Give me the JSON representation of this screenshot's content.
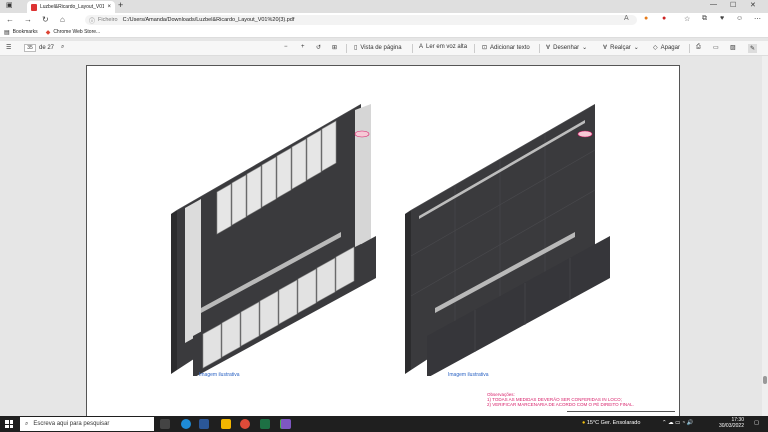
{
  "tab": {
    "title": "Luzbel&Ricardo_Layout_V01 (3)...",
    "close": "×"
  },
  "address": {
    "label": "Ficheiro",
    "url": "C:/Users/Amanda/Downloads/Luzbel&Ricardo_Layout_V01%20(3).pdf"
  },
  "bookmarks": [
    {
      "label": "Bookmarks"
    },
    {
      "label": "Chrome Web Store..."
    }
  ],
  "pdf_toolbar": {
    "page_current": "35",
    "page_total": "de 27",
    "page_view": "Vista de página",
    "read_aloud": "Ler em voz alta",
    "add_text": "Adicionar texto",
    "draw": "Desenhar",
    "highlight": "Realçar",
    "erase": "Apagar"
  },
  "document": {
    "captions": [
      "Imagem ilustrativa",
      "Imagem ilustrativa"
    ],
    "notes_title": "Observações:",
    "notes": [
      "1) TODAS AS MEDIDAS DEVERÃO SER CONFERIDAS IN LOCO;",
      "2) VERIFICAR MARCENARIA DE ACORDO COM O PÉ DIREITO FINAL."
    ],
    "tag_label": "A1"
  },
  "taskbar": {
    "search_placeholder": "Escreva aqui para pesquisar",
    "weather": "15°C  Ger. Ensolarado",
    "time": "17:30",
    "date": "30/03/2022"
  },
  "colors": {
    "panel_dark": "#3a3a3d",
    "panel_light": "#e4e4e4",
    "caption": "#2b63c4",
    "notes": "#d8206a",
    "taskbar": "#1f1f1f"
  }
}
